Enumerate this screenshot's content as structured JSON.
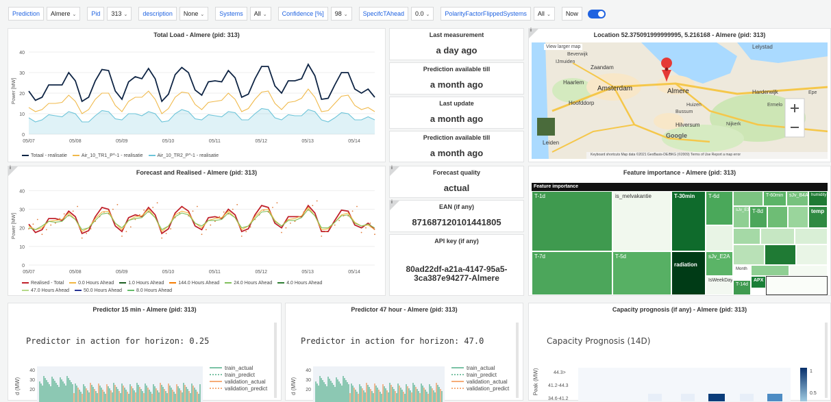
{
  "toolbar": {
    "items": [
      {
        "label": "Prediction",
        "value": "Almere"
      },
      {
        "label": "Pid",
        "value": "313"
      },
      {
        "label": "description",
        "value": "None"
      },
      {
        "label": "Systems",
        "value": "All"
      },
      {
        "label": "Confidence [%]",
        "value": "98"
      },
      {
        "label": "SpecifcTAhead",
        "value": "0.0"
      },
      {
        "label": "PolarityFactorFlippedSystems",
        "value": "All"
      }
    ],
    "now_label": "Now",
    "now_on": true
  },
  "panels": {
    "total_load": {
      "title": "Total Load - Almere (pid: 313)",
      "legend": [
        "Totaal - realisatie",
        "Air_10_TR1_P^-1 - realisatie",
        "Air_10_TR2_P^-1 - realisatie"
      ]
    },
    "last_measurement": {
      "title": "Last measurement",
      "value": "a day ago"
    },
    "prediction_till_1": {
      "title": "Prediction available till",
      "value": "a month ago"
    },
    "last_update": {
      "title": "Last update",
      "value": "a month ago"
    },
    "prediction_till_2": {
      "title": "Prediction available till",
      "value": "a month ago"
    },
    "location": {
      "title": "Location 52.375091999999995, 5.216168 - Almere (pid: 313)",
      "labels": {
        "beverwijk": "Beverwijk",
        "umuiden": "IJmuiden",
        "zaandam": "Zaandam",
        "lelystad": "Lelystad",
        "haarlem": "Haarlem",
        "amsterdam": "Amsterdam",
        "almere": "Almere",
        "harderwijk": "Harderwijk",
        "hoofddorp": "Hoofddorp",
        "huizen": "Huizen",
        "bussum": "Bussum",
        "ermelo": "Ermelo",
        "hilversum": "Hilversum",
        "nijkerk": "Nijkerk",
        "leiden": "Leiden",
        "epe": "Epe",
        "google": "Google",
        "larger_map": "View larger map"
      },
      "footer": "Keyboard shortcuts   Map data ©2021 GeoBasis-DE/BKG (©2009)   Terms of Use   Report a map error"
    },
    "forecast": {
      "title": "Forecast and Realised - Almere (pid: 313)",
      "legend_row1": [
        "Realised - Total",
        "0.0 Hours Ahead",
        "1.0 Hours Ahead",
        "144.0 Hours Ahead",
        "24.0 Hours Ahead",
        "4.0 Hours Ahead"
      ],
      "legend_row2": [
        "47.0 Hours Ahead",
        "50.0 Hours Ahead",
        "8.0 Hours Ahead"
      ]
    },
    "forecast_quality": {
      "title": "Forecast quality",
      "value": "actual"
    },
    "ean": {
      "title": "EAN (if any)",
      "value": "871687120101441805"
    },
    "api_key": {
      "title": "API key (if any)",
      "value_line1": "80ad22df-a21a-4147-95a5-",
      "value_line2": "3ca387e94277-Almere"
    },
    "feature_importance": {
      "title": "Feature importance - Almere (pid: 313)",
      "header": "Feature importance",
      "cells": [
        "T-1d",
        "is_melvakantie",
        "T-30min",
        "T-6d",
        "T-7d",
        "T-5d",
        "radiation",
        "sJv_E2A",
        "IsWeekDay",
        "T-14d",
        "APX",
        "T-60min",
        "sJv_B4A",
        "humidity",
        "temp",
        "T-8d",
        "Month",
        "sJv_E3C"
      ]
    },
    "predictor_15": {
      "title": "Predictor 15 min - Almere (pid: 313)",
      "heading": "Predictor in action for horizon: 0.25"
    },
    "predictor_47": {
      "title": "Predictor 47 hour - Almere (pid: 313)",
      "heading": "Predictor in action for horizon: 47.0"
    },
    "predictor_legend": [
      "train_actual",
      "train_predict",
      "validation_actual",
      "validation_predict"
    ],
    "predictor_ylabel": "d (MW)",
    "capacity": {
      "title": "Capacity prognosis (if any) - Almere (pid: 313)",
      "heading": "Capacity Prognosis (14D)",
      "ylabel": "Peak (MW)",
      "rows": [
        "44.3>",
        "41.2-44.3",
        "34.6-41.2"
      ],
      "scale": [
        "1",
        "0.5"
      ]
    }
  },
  "chart_data": [
    {
      "type": "line",
      "title": "Total Load - Almere (pid: 313)",
      "ylabel": "Power [MW]",
      "x_ticks": [
        "05/07",
        "05/08",
        "05/09",
        "05/10",
        "05/11",
        "05/12",
        "05/13",
        "05/14"
      ],
      "y_ticks": [
        0,
        10,
        20,
        30,
        40
      ],
      "ylim": [
        0,
        42
      ],
      "series": [
        {
          "name": "Totaal - realisatie",
          "color": "#0e2444",
          "values": [
            21,
            18,
            24,
            30,
            16,
            26,
            31,
            17,
            28,
            32,
            16,
            29,
            30,
            19,
            26,
            31,
            18,
            27,
            33,
            20,
            26,
            34,
            17,
            24,
            30,
            20,
            18
          ]
        },
        {
          "name": "Air_10_TR1_P^-1 - realisatie",
          "color": "#f0b94a",
          "values": [
            13,
            12,
            15,
            19,
            10,
            17,
            20,
            11,
            18,
            21,
            10,
            18,
            20,
            12,
            16,
            20,
            11,
            17,
            21,
            12,
            16,
            22,
            11,
            15,
            19,
            12,
            11
          ]
        },
        {
          "name": "Air_10_TR2_P^-1 - realisatie",
          "color": "#6cc4d9",
          "values": [
            8,
            7,
            9,
            11,
            6,
            9,
            11,
            7,
            10,
            11,
            6,
            10,
            11,
            7,
            9,
            11,
            7,
            10,
            12,
            7,
            9,
            12,
            7,
            8,
            10,
            7,
            7
          ]
        }
      ]
    },
    {
      "type": "line",
      "title": "Forecast and Realised - Almere (pid: 313)",
      "ylabel": "Power [MW]",
      "x_ticks": [
        "05/07",
        "05/08",
        "05/09",
        "05/10",
        "05/11",
        "05/12",
        "05/13",
        "05/14"
      ],
      "y_ticks": [
        0,
        10,
        20,
        30,
        40
      ],
      "ylim": [
        0,
        42
      ],
      "series": [
        {
          "name": "Realised - Total",
          "color": "#c0202a",
          "values": [
            22,
            19,
            25,
            29,
            17,
            26,
            30,
            18,
            27,
            31,
            17,
            28,
            29,
            19,
            26,
            30,
            18,
            27,
            31,
            20,
            26,
            32,
            18,
            24,
            29,
            20,
            19
          ]
        },
        {
          "name": "0.0 Hours Ahead",
          "color": "#f2b640",
          "values": [
            21,
            20,
            24,
            28,
            18,
            25,
            29,
            19,
            26,
            30,
            18,
            27,
            28,
            20,
            25,
            29,
            19,
            26,
            30,
            21,
            25,
            31,
            19,
            23,
            28,
            21,
            19
          ]
        },
        {
          "name": "24.0 Hours Ahead",
          "color": "#7fbf5a",
          "values": [
            20,
            21,
            23,
            27,
            19,
            24,
            28,
            20,
            25,
            29,
            19,
            26,
            27,
            21,
            24,
            28,
            20,
            25,
            29,
            21,
            24,
            30,
            20,
            23,
            27,
            21,
            20
          ]
        }
      ]
    }
  ]
}
